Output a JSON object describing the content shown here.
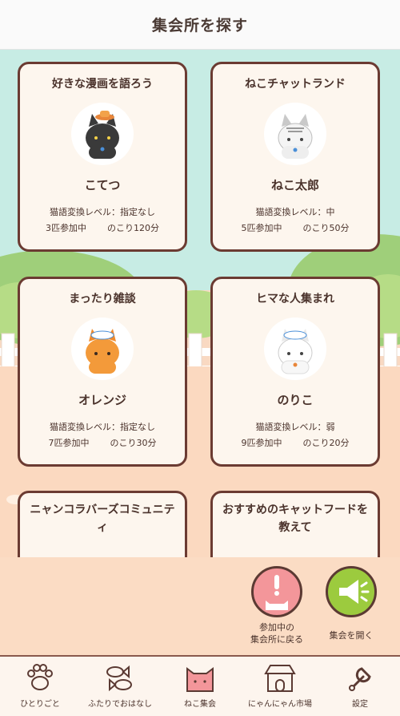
{
  "header": {
    "title": "集会所を探す"
  },
  "rooms": [
    {
      "title": "好きな漫画を語ろう",
      "host": "こてつ",
      "level": "猫語変換レベル：指定なし",
      "participants": "3匹参加中",
      "remaining": "のこり120分",
      "cat": "black-cat-icon"
    },
    {
      "title": "ねこチャットランド",
      "host": "ねこ太郎",
      "level": "猫語変換レベル：中",
      "participants": "5匹参加中",
      "remaining": "のこり50分",
      "cat": "tabby-cat-icon"
    },
    {
      "title": "まったり雑談",
      "host": "オレンジ",
      "level": "猫語変換レベル：指定なし",
      "participants": "7匹参加中",
      "remaining": "のこり30分",
      "cat": "orange-cat-icon"
    },
    {
      "title": "ヒマな人集まれ",
      "host": "のりこ",
      "level": "猫語変換レベル：弱",
      "participants": "9匹参加中",
      "remaining": "のこり20分",
      "cat": "white-cat-icon"
    },
    {
      "title": "ニャンコラバーズコミュニティ"
    },
    {
      "title": "おすすめのキャットフードを教えて"
    }
  ],
  "actions": {
    "return_label_1": "参加中の",
    "return_label_2": "集会所に戻る",
    "open_label": "集会を開く"
  },
  "tabs": [
    {
      "label": "ひとりごと",
      "icon": "paw-icon"
    },
    {
      "label": "ふたりでおはなし",
      "icon": "fish-icon"
    },
    {
      "label": "ねこ集会",
      "icon": "cat-face-icon"
    },
    {
      "label": "にゃんにゃん市場",
      "icon": "shop-icon"
    },
    {
      "label": "設定",
      "icon": "wrench-icon"
    }
  ],
  "colors": {
    "card_border": "#6b3b32",
    "active_tab": "#f3969a",
    "open_button": "#9ccb3e",
    "return_button": "#f3969a"
  }
}
